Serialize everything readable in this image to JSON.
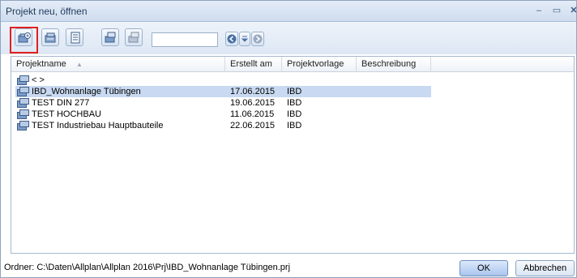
{
  "window": {
    "title": "Projekt neu, öffnen"
  },
  "toolbar": {
    "search_value": "",
    "buttons": [
      "new-project-icon",
      "open-project-icon",
      "properties-icon",
      "copy-icon",
      "delete-icon"
    ]
  },
  "columns": [
    "Projektname",
    "Erstellt am",
    "Projektvorlage",
    "Beschreibung"
  ],
  "rows": [
    {
      "name": "<     >",
      "date": "",
      "template": "",
      "desc": ""
    },
    {
      "name": "IBD_Wohnanlage Tübingen",
      "date": "17.06.2015",
      "template": "IBD",
      "desc": "",
      "selected": true
    },
    {
      "name": "TEST DIN 277",
      "date": "19.06.2015",
      "template": "IBD",
      "desc": ""
    },
    {
      "name": "TEST HOCHBAU",
      "date": "11.06.2015",
      "template": "IBD",
      "desc": ""
    },
    {
      "name": "TEST Industriebau Hauptbauteile",
      "date": "22.06.2015",
      "template": "IBD",
      "desc": ""
    }
  ],
  "footer": {
    "path": "Ordner: C:\\Daten\\Allplan\\Allplan 2016\\Prj\\IBD_Wohnanlage Tübingen.prj",
    "ok_label": "OK",
    "cancel_label": "Abbrechen"
  },
  "colors": {
    "selection": "#c8d9f1",
    "highlight_border": "#e02020"
  }
}
